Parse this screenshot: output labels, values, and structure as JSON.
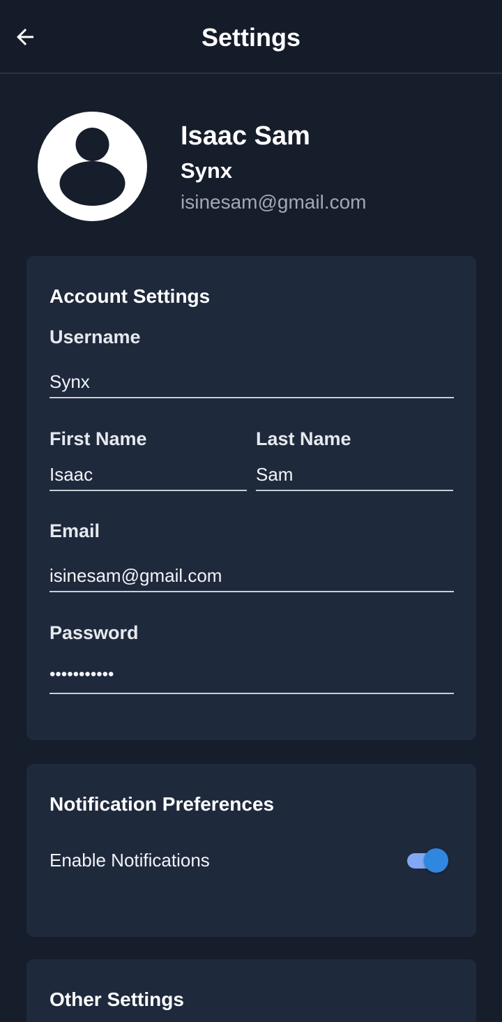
{
  "header": {
    "title": "Settings",
    "back_icon": "arrow-left-icon"
  },
  "profile": {
    "avatar_icon": "user-avatar-icon",
    "name": "Isaac Sam",
    "username": "Synx",
    "email": "isinesam@gmail.com"
  },
  "account": {
    "title": "Account Settings",
    "username_label": "Username",
    "username_value": "Synx",
    "first_name_label": "First Name",
    "first_name_value": "Isaac",
    "last_name_label": "Last Name",
    "last_name_value": "Sam",
    "email_label": "Email",
    "email_value": "isinesam@gmail.com",
    "password_label": "Password",
    "password_value": "•••••••••••"
  },
  "notifications": {
    "title": "Notification Preferences",
    "enable_label": "Enable Notifications",
    "enabled": true
  },
  "other": {
    "title": "Other Settings"
  },
  "colors": {
    "background": "#161d2b",
    "card": "#1f293c",
    "toggle_track": "#82a8f4",
    "toggle_knob": "#2f87e0",
    "muted_text": "#a1a8b6"
  }
}
